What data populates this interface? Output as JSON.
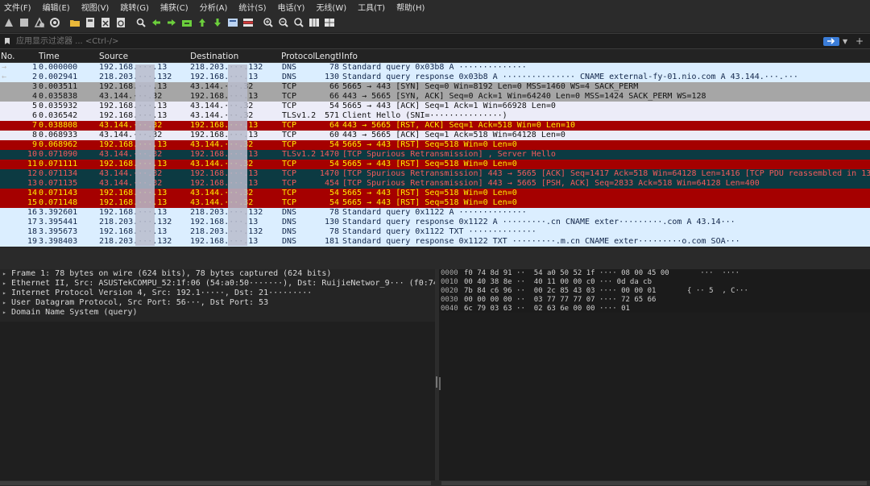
{
  "menu": [
    "文件(F)",
    "编辑(E)",
    "视图(V)",
    "跳转(G)",
    "捕获(C)",
    "分析(A)",
    "统计(S)",
    "电话(Y)",
    "无线(W)",
    "工具(T)",
    "帮助(H)"
  ],
  "toolbar": {
    "icons": [
      "shark-fin-start-icon",
      "stop-square-icon",
      "restart-fin-icon",
      "capture-options-gear-icon",
      "open-folder-icon",
      "file-save-icon",
      "close-file-icon",
      "reload-icon",
      "find-packet-icon",
      "go-back-icon",
      "go-forward-icon",
      "go-to-packet-icon",
      "go-first-icon",
      "go-last-icon",
      "autoscroll-icon",
      "colorize-icon",
      "zoom-in-icon",
      "zoom-out-icon",
      "zoom-normal-icon",
      "resize-columns-icon",
      "layout-grid-icon"
    ]
  },
  "filter": {
    "placeholder": "应用显示过滤器 ... <Ctrl-/>"
  },
  "columns": {
    "no": "No.",
    "time": "Time",
    "source": "Source",
    "destination": "Destination",
    "protocol": "Protocol",
    "length": "Length",
    "info": "Info"
  },
  "packets": [
    {
      "arrow": "→",
      "no": "1",
      "time": "0.000000",
      "src": "192.168.···.13",
      "dst": "218.203.···.132",
      "proto": "DNS",
      "len": "78",
      "info": "Standard query 0x03b8 A ··············",
      "style": "dns"
    },
    {
      "arrow": "←",
      "no": "2",
      "time": "0.002941",
      "src": "218.203.···.132",
      "dst": "192.168.···.13",
      "proto": "DNS",
      "len": "130",
      "info": "Standard query response 0x03b8 A ··············· CNAME external-fy-01.nio.com A 43.144.···.···",
      "style": "dns"
    },
    {
      "arrow": "",
      "no": "3",
      "time": "0.003511",
      "src": "192.168.···.13",
      "dst": "43.144.···.32",
      "proto": "TCP",
      "len": "66",
      "info": "5665 → 443 [SYN] Seq=0 Win=8192 Len=0 MSS=1460 WS=4 SACK_PERM",
      "style": "tcp-gray"
    },
    {
      "arrow": "",
      "no": "4",
      "time": "0.035838",
      "src": "43.144.···.32",
      "dst": "192.168.···.13",
      "proto": "TCP",
      "len": "66",
      "info": "443 → 5665 [SYN, ACK] Seq=0 Ack=1 Win=64240 Len=0 MSS=1424 SACK_PERM WS=128",
      "style": "tcp-gray"
    },
    {
      "arrow": "",
      "no": "5",
      "time": "0.035932",
      "src": "192.168.···.13",
      "dst": "43.144.···.32",
      "proto": "TCP",
      "len": "54",
      "info": "5665 → 443 [ACK] Seq=1 Ack=1 Win=66928 Len=0",
      "style": "tcp-light"
    },
    {
      "arrow": "",
      "no": "6",
      "time": "0.036542",
      "src": "192.168.···.13",
      "dst": "43.144.···.32",
      "proto": "TLSv1.2",
      "len": "571",
      "info": "Client Hello (SNI=···············)",
      "style": "tls"
    },
    {
      "arrow": "",
      "no": "7",
      "time": "0.038808",
      "src": "43.144.···.32",
      "dst": "192.168.···.13",
      "proto": "TCP",
      "len": "64",
      "info": "443 → 5665 [RST, ACK] Seq=1 Ack=518 Win=0 Len=10",
      "style": "rst"
    },
    {
      "arrow": "",
      "no": "8",
      "time": "0.068933",
      "src": "43.144.···.32",
      "dst": "192.168.···.13",
      "proto": "TCP",
      "len": "60",
      "info": "443 → 5665 [ACK] Seq=1 Ack=518 Win=64128 Len=0",
      "style": "tcp-light"
    },
    {
      "arrow": "",
      "no": "9",
      "time": "0.068962",
      "src": "192.168.···.13",
      "dst": "43.144.···.32",
      "proto": "TCP",
      "len": "54",
      "info": "5665 → 443 [RST] Seq=518 Win=0 Len=0",
      "style": "rst"
    },
    {
      "arrow": "",
      "no": "10",
      "time": "0.071090",
      "src": "43.144.···.32",
      "dst": "192.168.···.13",
      "proto": "TLSv1.2",
      "len": "1470",
      "info": "[TCP Spurious Retransmission] , Server Hello",
      "style": "dark"
    },
    {
      "arrow": "",
      "no": "11",
      "time": "0.071111",
      "src": "192.168.···.13",
      "dst": "43.144.···.32",
      "proto": "TCP",
      "len": "54",
      "info": "5665 → 443 [RST] Seq=518 Win=0 Len=0",
      "style": "rst"
    },
    {
      "arrow": "",
      "no": "12",
      "time": "0.071134",
      "src": "43.144.···.32",
      "dst": "192.168.···.13",
      "proto": "TCP",
      "len": "1470",
      "info": "[TCP Spurious Retransmission] 443 → 5665 [ACK] Seq=1417 Ack=518 Win=64128 Len=1416 [TCP PDU reassembled in 13]",
      "style": "dark"
    },
    {
      "arrow": "",
      "no": "13",
      "time": "0.071135",
      "src": "43.144.···.32",
      "dst": "192.168.···.13",
      "proto": "TCP",
      "len": "454",
      "info": "[TCP Spurious Retransmission] 443 → 5665 [PSH, ACK] Seq=2833 Ack=518 Win=64128 Len=400",
      "style": "dark"
    },
    {
      "arrow": "",
      "no": "14",
      "time": "0.071143",
      "src": "192.168.···.13",
      "dst": "43.144.···.32",
      "proto": "TCP",
      "len": "54",
      "info": "5665 → 443 [RST] Seq=518 Win=0 Len=0",
      "style": "rst"
    },
    {
      "arrow": "",
      "no": "15",
      "time": "0.071148",
      "src": "192.168.···.13",
      "dst": "43.144.···.32",
      "proto": "TCP",
      "len": "54",
      "info": "5665 → 443 [RST] Seq=518 Win=0 Len=0",
      "style": "rst"
    },
    {
      "arrow": "",
      "no": "16",
      "time": "3.392601",
      "src": "192.168.···.13",
      "dst": "218.203.···.132",
      "proto": "DNS",
      "len": "78",
      "info": "Standard query 0x1122 A ··············",
      "style": "dns"
    },
    {
      "arrow": "",
      "no": "17",
      "time": "3.395441",
      "src": "218.203.···.132",
      "dst": "192.168.···.13",
      "proto": "DNS",
      "len": "130",
      "info": "Standard query response 0x1122 A ·········.cn CNAME exter·········.com A 43.14···",
      "style": "dns"
    },
    {
      "arrow": "",
      "no": "18",
      "time": "3.395673",
      "src": "192.168.···.13",
      "dst": "218.203.···.132",
      "proto": "DNS",
      "len": "78",
      "info": "Standard query 0x1122 TXT ··············",
      "style": "dns"
    },
    {
      "arrow": "",
      "no": "19",
      "time": "3.398403",
      "src": "218.203.···.132",
      "dst": "192.168.···.13",
      "proto": "DNS",
      "len": "181",
      "info": "Standard query response 0x1122 TXT ·········.m.cn CNAME exter·········o.com SOA···",
      "style": "dns"
    }
  ],
  "details": [
    "Frame 1: 78 bytes on wire (624 bits), 78 bytes captured (624 bits)",
    "Ethernet II, Src: ASUSTekCOMPU_52:1f:06 (54:a0:50·······), Dst: RuijieNetwor_9··· (f0:74:8d···",
    "Internet Protocol Version 4, Src: 192.1·····, Dst: 21·········",
    "User Datagram Protocol, Src Port: 56···, Dst Port: 53",
    "Domain Name System (query)"
  ],
  "hex": [
    {
      "off": "0000",
      "bytes": "f0 74 8d 91 ··  54 a0 50 52 1f ···· 08 00 45 00",
      "ascii": "   ···  ···· "
    },
    {
      "off": "0010",
      "bytes": "00 40 38 8e ··  40 11 00 00 c0 ··· 0d da cb",
      "ascii": "              "
    },
    {
      "off": "0020",
      "bytes": "7b 84 c6 96 ··  00 2c 85 43 03 ···· 00 00 01",
      "ascii": "{ ·· 5  , C···"
    },
    {
      "off": "0030",
      "bytes": "00 00 00 00 ··  03 77 77 77 07 ···· 72 65 66",
      "ascii": "              "
    },
    {
      "off": "0040",
      "bytes": "6c 79 03 63 ··  02 63 6e 00 00 ···· 01",
      "ascii": "              "
    }
  ]
}
